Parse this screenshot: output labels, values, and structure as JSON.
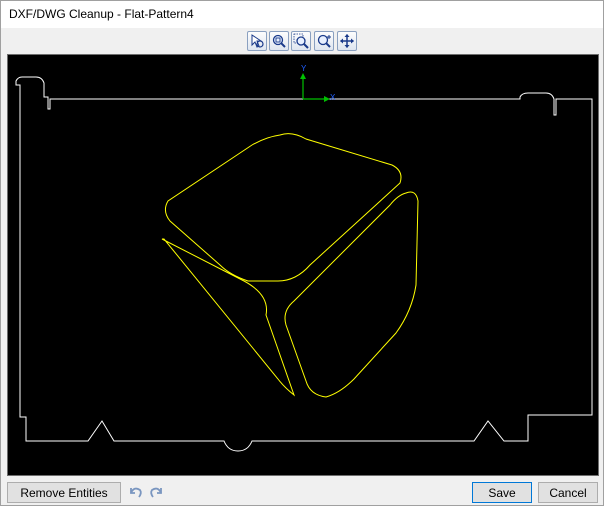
{
  "window": {
    "title": "DXF/DWG Cleanup - Flat-Pattern4"
  },
  "toolbar": {
    "tools": [
      {
        "name": "select-tool-icon"
      },
      {
        "name": "zoom-to-fit-icon"
      },
      {
        "name": "zoom-to-area-icon"
      },
      {
        "name": "zoom-in-out-icon"
      },
      {
        "name": "pan-icon"
      }
    ]
  },
  "canvas": {
    "background": "#000000",
    "outline_color": "#ffffff",
    "geometry_color": "#ffff00",
    "axis": {
      "x_label": "X",
      "y_label": "Y",
      "x_color": "#00c000",
      "y_color": "#00c000",
      "label_color": "#2060ff"
    }
  },
  "footer": {
    "remove_entities_label": "Remove Entities",
    "undo_icon": "undo-icon",
    "redo_icon": "redo-icon",
    "save_label": "Save",
    "cancel_label": "Cancel"
  }
}
